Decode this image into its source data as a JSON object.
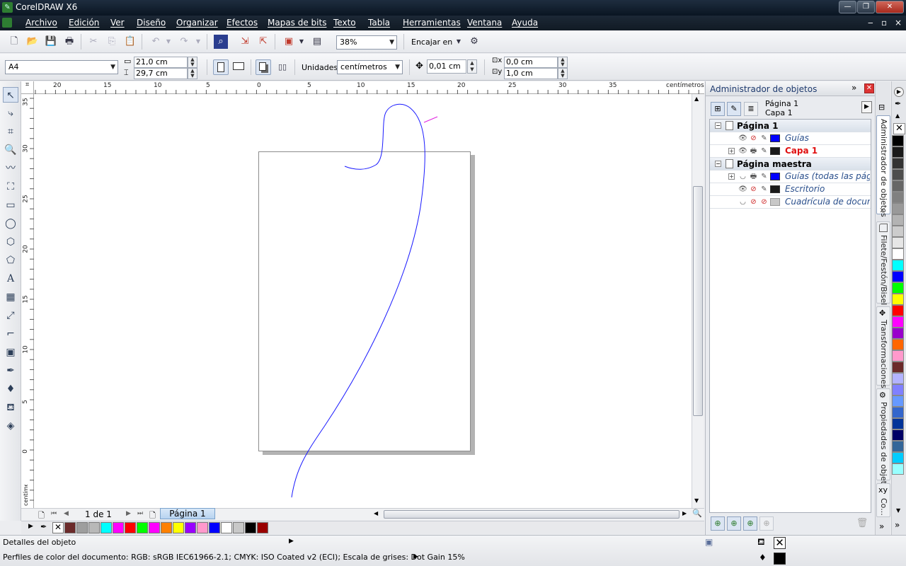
{
  "window": {
    "title": "CorelDRAW X6",
    "minimize": "—",
    "restore": "❐",
    "close": "✕"
  },
  "menu": [
    {
      "label": "Archivo"
    },
    {
      "label": "Edición"
    },
    {
      "label": "Ver"
    },
    {
      "label": "Diseño"
    },
    {
      "label": "Organizar"
    },
    {
      "label": "Efectos"
    },
    {
      "label": "Mapas de bits"
    },
    {
      "label": "Texto"
    },
    {
      "label": "Tabla"
    },
    {
      "label": "Herramientas"
    },
    {
      "label": "Ventana"
    },
    {
      "label": "Ayuda"
    }
  ],
  "doc_controls": {
    "min": "‒",
    "restore": "▫",
    "close": "×"
  },
  "toolbar": {
    "zoom": "38%",
    "snap_label": "Encajar en"
  },
  "property_bar": {
    "page_size": "A4",
    "width": "21,0 cm",
    "height": "29,7 cm",
    "units_label": "Unidades:",
    "units_value": "centímetros",
    "nudge": "0,01 cm",
    "dup_x": "0,0 cm",
    "dup_y": "1,0 cm"
  },
  "ruler": {
    "unit_label": "centímetros",
    "h_ticks": [
      "20",
      "15",
      "10",
      "5",
      "0",
      "5",
      "10",
      "15",
      "20",
      "25",
      "30",
      "35"
    ],
    "v_ticks": [
      "35",
      "30",
      "25",
      "20",
      "15",
      "10",
      "5",
      "0"
    ]
  },
  "navigator": {
    "page_count": "1 de 1",
    "page_tab": "Página 1"
  },
  "doc_palette": [
    "#6b2a2a",
    "#9e9e9e",
    "#b8b8b8",
    "#00ffff",
    "#ff00ff",
    "#ff0000",
    "#00ff00",
    "#ff00ff",
    "#ff8000",
    "#ffff00",
    "#9900ff",
    "#ff99cc",
    "#0000ff",
    "#ffffff",
    "#c8c8c8",
    "#000000",
    "#990000"
  ],
  "object_manager": {
    "title": "Administrador de objetos",
    "current_page": "Página 1",
    "current_layer": "Capa 1",
    "tree": [
      {
        "type": "page",
        "label": "Página 1"
      },
      {
        "type": "layer",
        "label": "Guías",
        "color": "#0000ff",
        "style": "normal"
      },
      {
        "type": "layer",
        "label": "Capa 1",
        "color": "#1a1a1a",
        "style": "active",
        "expandable": true
      },
      {
        "type": "page",
        "label": "Página maestra"
      },
      {
        "type": "layer",
        "label": "Guías (todas las págin",
        "color": "#0000ff",
        "style": "normal",
        "expandable": true
      },
      {
        "type": "layer",
        "label": "Escritorio",
        "color": "#1a1a1a",
        "style": "normal"
      },
      {
        "type": "layer",
        "label": "Cuadrícula de docume",
        "color": "#c8c8c8",
        "style": "normal"
      }
    ]
  },
  "side_tabs": [
    {
      "label": "Administrador de objetos"
    },
    {
      "label": "Filete/Festón/Bisel"
    },
    {
      "label": "Transformaciones"
    },
    {
      "label": "Propiedades de objeto"
    },
    {
      "label": "Co..."
    }
  ],
  "side_tab_xy": "xy",
  "right_palette": [
    "#000000",
    "#1a1a1a",
    "#333333",
    "#4d4d4d",
    "#666666",
    "#808080",
    "#999999",
    "#b3b3b3",
    "#cccccc",
    "#e6e6e6",
    "#ffffff",
    "#00ffff",
    "#0000ff",
    "#00ff00",
    "#ffff00",
    "#ff0000",
    "#ff00ff",
    "#9900cc",
    "#ff6600",
    "#ff99cc",
    "#6b2a2a",
    "#b3b3ff",
    "#8080ff",
    "#6699ff",
    "#3366cc",
    "#003399",
    "#000066",
    "#336699",
    "#00ccff",
    "#99ffff"
  ],
  "status": {
    "object_details": "Detalles del objeto",
    "color_profiles": "Perfiles de color del documento: RGB: sRGB IEC61966-2.1; CMYK: ISO Coated v2 (ECI); Escala de grises: Dot Gain 15%"
  }
}
